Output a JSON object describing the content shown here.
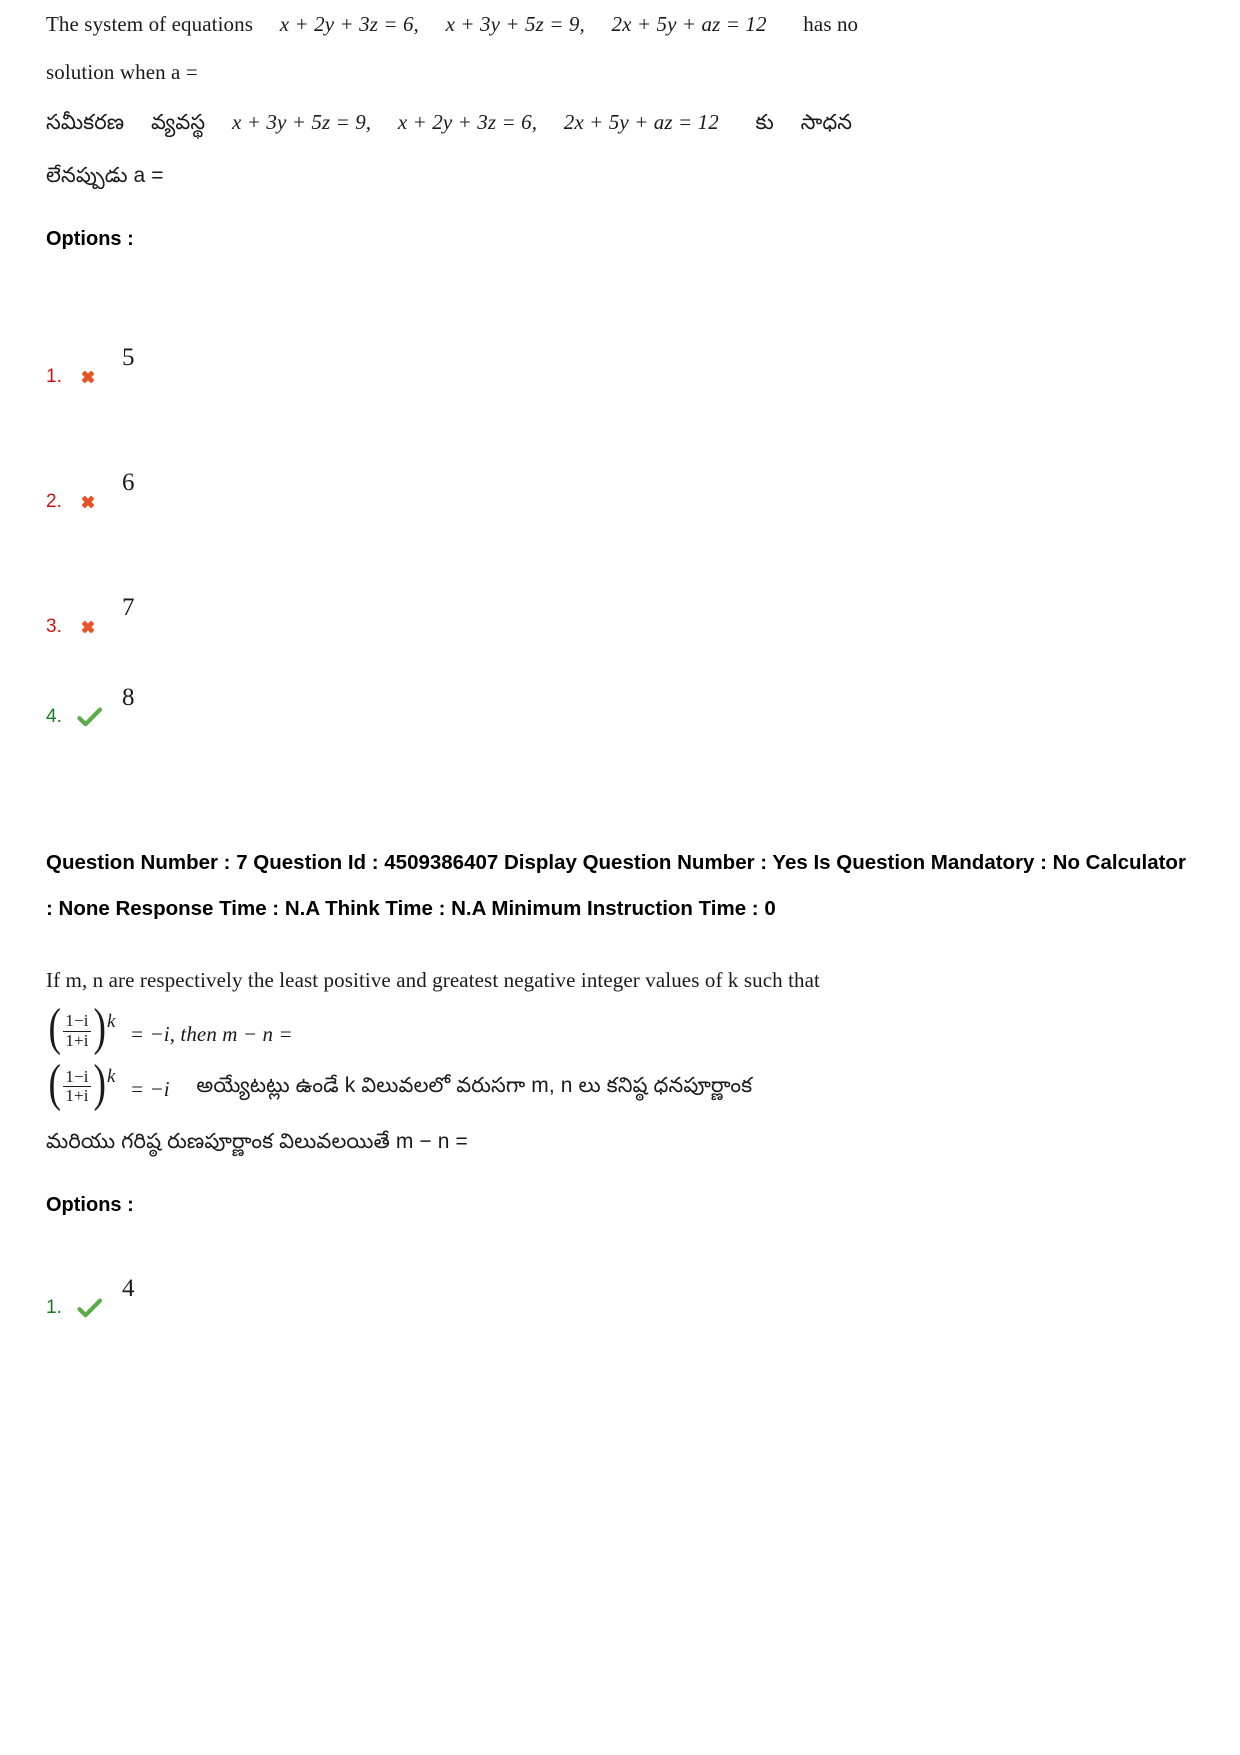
{
  "page": {
    "background": "#ffffff",
    "wrong_color": "#cc1111",
    "correct_color": "#1e7a1e",
    "mark_wrong_color": "#e8542a",
    "mark_correct_color": "#5bab4a"
  },
  "question6": {
    "english_line1": "The  system  of  equations",
    "english_eq1": "x + 2y + 3z = 6,",
    "english_eq2": "x + 3y + 5z = 9,",
    "english_eq3": "2x + 5y + az = 12",
    "english_tail": "has  no",
    "english_line2": "solution when a =",
    "telugu_label1": "సమీకరణ",
    "telugu_label2": "వ్యవస్థ",
    "telugu_eq1": "x + 3y + 5z = 9,",
    "telugu_eq2": "x + 2y + 3z = 6,",
    "telugu_eq3": "2x + 5y + az = 12",
    "telugu_mid": "కు",
    "telugu_tail": "సాధన",
    "telugu_line2": "లేనప్పుడు a =",
    "options_label": "Options :",
    "options": [
      {
        "number": "1.",
        "mark": "cross-icon",
        "status": "wrong",
        "value": "5"
      },
      {
        "number": "2.",
        "mark": "cross-icon",
        "status": "wrong",
        "value": "6"
      },
      {
        "number": "3.",
        "mark": "cross-icon",
        "status": "wrong",
        "value": "7"
      },
      {
        "number": "4.",
        "mark": "check-icon",
        "status": "correct",
        "value": "8"
      }
    ]
  },
  "question7": {
    "meta": "Question Number : 7 Question Id : 4509386407 Display Question Number : Yes Is Question Mandatory : No Calculator : None Response Time : N.A Think Time : N.A Minimum Instruction Time : 0",
    "meta_fields": {
      "question_number_label": "Question Number :",
      "question_number": "7",
      "question_id_label": "Question Id :",
      "question_id": "4509386407",
      "display_question_number_label": "Display Question Number :",
      "display_question_number": "Yes",
      "is_question_mandatory_label": "Is Question Mandatory :",
      "is_question_mandatory": "No",
      "calculator_label": "Calculator :",
      "calculator": "None",
      "response_time_label": "Response Time :",
      "response_time": "N.A",
      "think_time_label": "Think Time :",
      "think_time": "N.A",
      "minimum_instruction_time_label": "Minimum Instruction Time :",
      "minimum_instruction_time": "0"
    },
    "english_line1": "If m, n are respectively the least positive and greatest negative integer values of k such that",
    "frac_num": "1−i",
    "frac_den": "1+i",
    "exponent": "k",
    "english_eq_tail": "= −i, then m − n =",
    "telugu_eq_tail": "= −i",
    "telugu_line1": "అయ్యేటట్లు  ఉండే  k  విలువలలో  వరుసగా  m, n  లు  కనిష్ఠ  ధనపూర్ణాంక",
    "telugu_line2": "మరియు గరిష్ఠ రుణపూర్ణాంక విలువలయితే m − n =",
    "options_label": "Options :",
    "options": [
      {
        "number": "1.",
        "mark": "check-icon",
        "status": "correct",
        "value": "4"
      }
    ]
  }
}
